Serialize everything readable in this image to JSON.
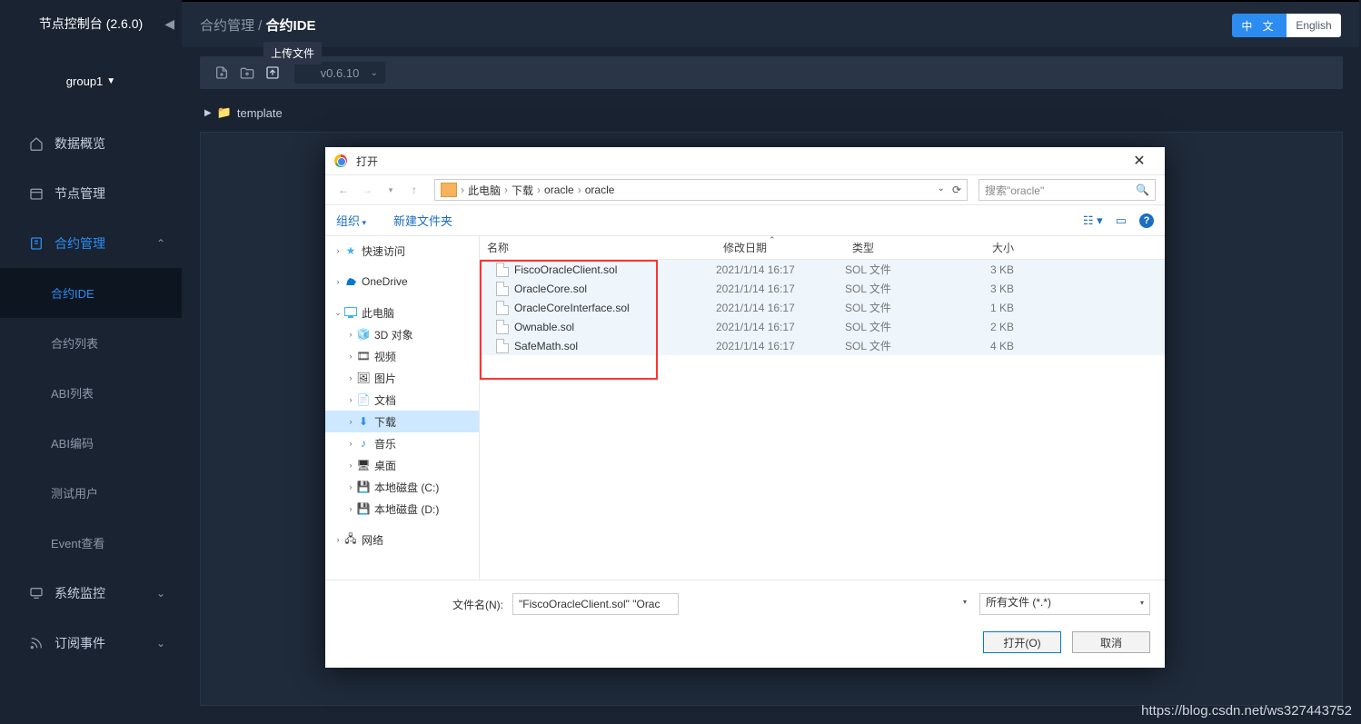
{
  "console": {
    "title": "节点控制台 (2.6.0)",
    "group": "group1"
  },
  "breadcrumb": {
    "parent": "合约管理",
    "sep": " / ",
    "current": "合约IDE"
  },
  "lang": {
    "zh": "中 文",
    "en": "English"
  },
  "toolbar": {
    "version": "v0.6.10",
    "tooltip": "上传文件"
  },
  "tree": {
    "template": "template"
  },
  "nav": {
    "overview": "数据概览",
    "nodes": "节点管理",
    "contracts": "合约管理",
    "sub": {
      "ide": "合约IDE",
      "list": "合约列表",
      "abi": "ABI列表",
      "abienc": "ABI编码",
      "testuser": "测试用户",
      "event": "Event查看"
    },
    "monitor": "系统监控",
    "subscribe": "订阅事件"
  },
  "dialog": {
    "title": "打开",
    "path": [
      "此电脑",
      "下载",
      "oracle",
      "oracle"
    ],
    "search_placeholder": "搜索\"oracle\"",
    "organize": "组织",
    "newfolder": "新建文件夹",
    "columns": {
      "name": "名称",
      "modified": "修改日期",
      "type": "类型",
      "size": "大小"
    },
    "side": {
      "quick": "快速访问",
      "onedrive": "OneDrive",
      "thispc": "此电脑",
      "obj3d": "3D 对象",
      "video": "视频",
      "picture": "图片",
      "doc": "文档",
      "download": "下载",
      "music": "音乐",
      "desktop": "桌面",
      "diskc": "本地磁盘 (C:)",
      "diskd": "本地磁盘 (D:)",
      "network": "网络"
    },
    "files": [
      {
        "name": "FiscoOracleClient.sol",
        "date": "2021/1/14 16:17",
        "type": "SOL 文件",
        "size": "3 KB"
      },
      {
        "name": "OracleCore.sol",
        "date": "2021/1/14 16:17",
        "type": "SOL 文件",
        "size": "3 KB"
      },
      {
        "name": "OracleCoreInterface.sol",
        "date": "2021/1/14 16:17",
        "type": "SOL 文件",
        "size": "1 KB"
      },
      {
        "name": "Ownable.sol",
        "date": "2021/1/14 16:17",
        "type": "SOL 文件",
        "size": "2 KB"
      },
      {
        "name": "SafeMath.sol",
        "date": "2021/1/14 16:17",
        "type": "SOL 文件",
        "size": "4 KB"
      }
    ],
    "filename_label": "文件名(N):",
    "filename_value": "\"FiscoOracleClient.sol\" \"OracleCore.sol\" \"OracleCoreInterface.sol\" \"Ownable.sol\" \"Sa",
    "filetype": "所有文件 (*.*)",
    "open_btn": "打开(O)",
    "cancel_btn": "取消"
  },
  "watermark": "https://blog.csdn.net/ws327443752"
}
